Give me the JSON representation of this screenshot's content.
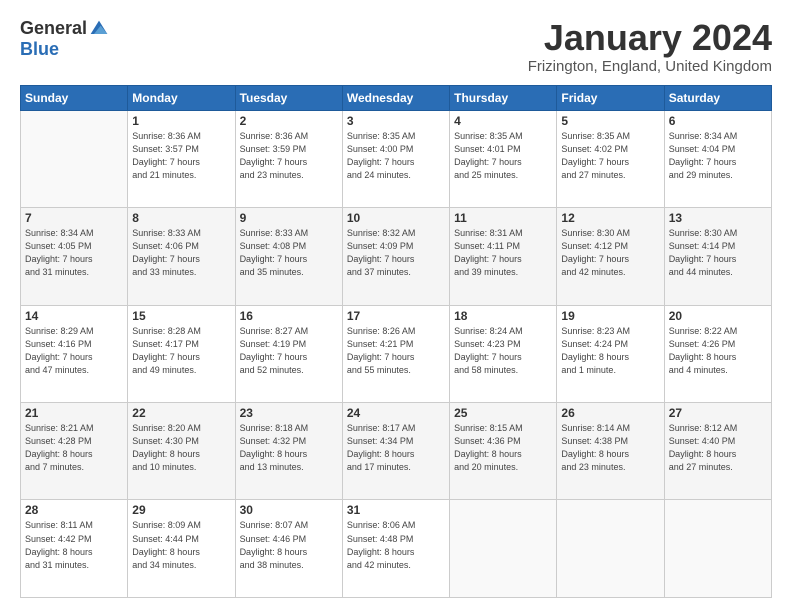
{
  "header": {
    "logo": {
      "general": "General",
      "blue": "Blue"
    },
    "title": "January 2024",
    "location": "Frizington, England, United Kingdom"
  },
  "calendar": {
    "headers": [
      "Sunday",
      "Monday",
      "Tuesday",
      "Wednesday",
      "Thursday",
      "Friday",
      "Saturday"
    ],
    "rows": [
      {
        "shade": "white",
        "cells": [
          {
            "day": "",
            "info": ""
          },
          {
            "day": "1",
            "info": "Sunrise: 8:36 AM\nSunset: 3:57 PM\nDaylight: 7 hours\nand 21 minutes."
          },
          {
            "day": "2",
            "info": "Sunrise: 8:36 AM\nSunset: 3:59 PM\nDaylight: 7 hours\nand 23 minutes."
          },
          {
            "day": "3",
            "info": "Sunrise: 8:35 AM\nSunset: 4:00 PM\nDaylight: 7 hours\nand 24 minutes."
          },
          {
            "day": "4",
            "info": "Sunrise: 8:35 AM\nSunset: 4:01 PM\nDaylight: 7 hours\nand 25 minutes."
          },
          {
            "day": "5",
            "info": "Sunrise: 8:35 AM\nSunset: 4:02 PM\nDaylight: 7 hours\nand 27 minutes."
          },
          {
            "day": "6",
            "info": "Sunrise: 8:34 AM\nSunset: 4:04 PM\nDaylight: 7 hours\nand 29 minutes."
          }
        ]
      },
      {
        "shade": "shade",
        "cells": [
          {
            "day": "7",
            "info": "Sunrise: 8:34 AM\nSunset: 4:05 PM\nDaylight: 7 hours\nand 31 minutes."
          },
          {
            "day": "8",
            "info": "Sunrise: 8:33 AM\nSunset: 4:06 PM\nDaylight: 7 hours\nand 33 minutes."
          },
          {
            "day": "9",
            "info": "Sunrise: 8:33 AM\nSunset: 4:08 PM\nDaylight: 7 hours\nand 35 minutes."
          },
          {
            "day": "10",
            "info": "Sunrise: 8:32 AM\nSunset: 4:09 PM\nDaylight: 7 hours\nand 37 minutes."
          },
          {
            "day": "11",
            "info": "Sunrise: 8:31 AM\nSunset: 4:11 PM\nDaylight: 7 hours\nand 39 minutes."
          },
          {
            "day": "12",
            "info": "Sunrise: 8:30 AM\nSunset: 4:12 PM\nDaylight: 7 hours\nand 42 minutes."
          },
          {
            "day": "13",
            "info": "Sunrise: 8:30 AM\nSunset: 4:14 PM\nDaylight: 7 hours\nand 44 minutes."
          }
        ]
      },
      {
        "shade": "white",
        "cells": [
          {
            "day": "14",
            "info": "Sunrise: 8:29 AM\nSunset: 4:16 PM\nDaylight: 7 hours\nand 47 minutes."
          },
          {
            "day": "15",
            "info": "Sunrise: 8:28 AM\nSunset: 4:17 PM\nDaylight: 7 hours\nand 49 minutes."
          },
          {
            "day": "16",
            "info": "Sunrise: 8:27 AM\nSunset: 4:19 PM\nDaylight: 7 hours\nand 52 minutes."
          },
          {
            "day": "17",
            "info": "Sunrise: 8:26 AM\nSunset: 4:21 PM\nDaylight: 7 hours\nand 55 minutes."
          },
          {
            "day": "18",
            "info": "Sunrise: 8:24 AM\nSunset: 4:23 PM\nDaylight: 7 hours\nand 58 minutes."
          },
          {
            "day": "19",
            "info": "Sunrise: 8:23 AM\nSunset: 4:24 PM\nDaylight: 8 hours\nand 1 minute."
          },
          {
            "day": "20",
            "info": "Sunrise: 8:22 AM\nSunset: 4:26 PM\nDaylight: 8 hours\nand 4 minutes."
          }
        ]
      },
      {
        "shade": "shade",
        "cells": [
          {
            "day": "21",
            "info": "Sunrise: 8:21 AM\nSunset: 4:28 PM\nDaylight: 8 hours\nand 7 minutes."
          },
          {
            "day": "22",
            "info": "Sunrise: 8:20 AM\nSunset: 4:30 PM\nDaylight: 8 hours\nand 10 minutes."
          },
          {
            "day": "23",
            "info": "Sunrise: 8:18 AM\nSunset: 4:32 PM\nDaylight: 8 hours\nand 13 minutes."
          },
          {
            "day": "24",
            "info": "Sunrise: 8:17 AM\nSunset: 4:34 PM\nDaylight: 8 hours\nand 17 minutes."
          },
          {
            "day": "25",
            "info": "Sunrise: 8:15 AM\nSunset: 4:36 PM\nDaylight: 8 hours\nand 20 minutes."
          },
          {
            "day": "26",
            "info": "Sunrise: 8:14 AM\nSunset: 4:38 PM\nDaylight: 8 hours\nand 23 minutes."
          },
          {
            "day": "27",
            "info": "Sunrise: 8:12 AM\nSunset: 4:40 PM\nDaylight: 8 hours\nand 27 minutes."
          }
        ]
      },
      {
        "shade": "white",
        "cells": [
          {
            "day": "28",
            "info": "Sunrise: 8:11 AM\nSunset: 4:42 PM\nDaylight: 8 hours\nand 31 minutes."
          },
          {
            "day": "29",
            "info": "Sunrise: 8:09 AM\nSunset: 4:44 PM\nDaylight: 8 hours\nand 34 minutes."
          },
          {
            "day": "30",
            "info": "Sunrise: 8:07 AM\nSunset: 4:46 PM\nDaylight: 8 hours\nand 38 minutes."
          },
          {
            "day": "31",
            "info": "Sunrise: 8:06 AM\nSunset: 4:48 PM\nDaylight: 8 hours\nand 42 minutes."
          },
          {
            "day": "",
            "info": ""
          },
          {
            "day": "",
            "info": ""
          },
          {
            "day": "",
            "info": ""
          }
        ]
      }
    ]
  }
}
